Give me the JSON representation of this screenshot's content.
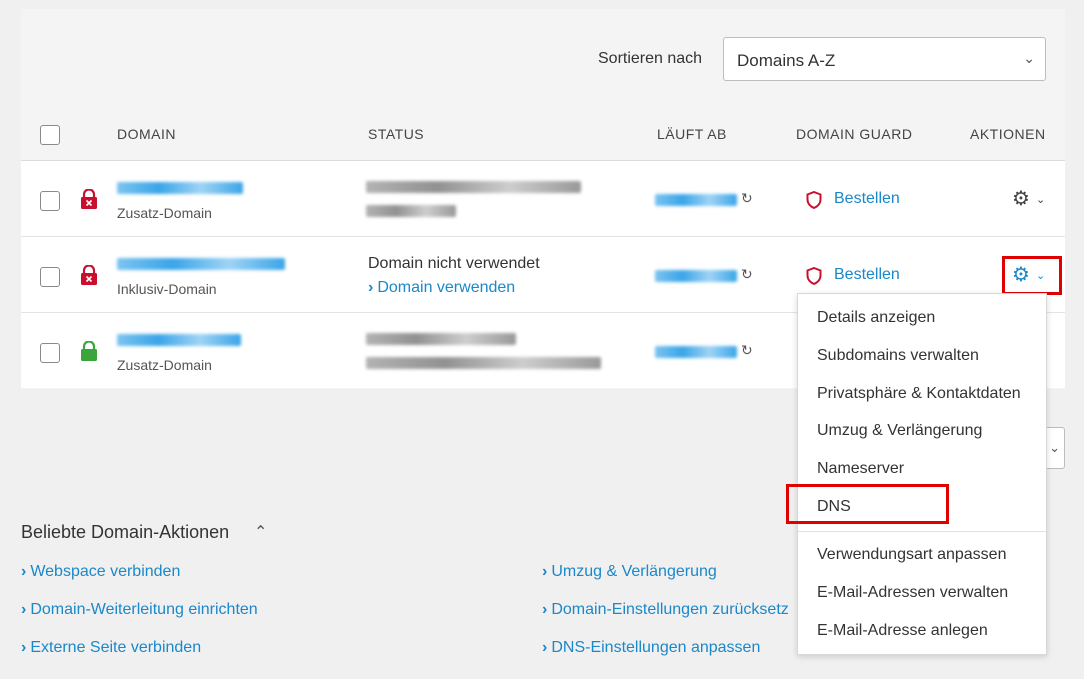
{
  "sort": {
    "label": "Sortieren nach",
    "value": "Domains A-Z"
  },
  "table": {
    "headers": {
      "domain": "DOMAIN",
      "status": "STATUS",
      "expires": "LÄUFT AB",
      "guard": "DOMAIN GUARD",
      "actions": "AKTIONEN"
    },
    "rows": [
      {
        "type": "Zusatz-Domain",
        "lock": "locked-red",
        "guard": "Bestellen"
      },
      {
        "type": "Inklusiv-Domain",
        "lock": "locked-red",
        "status_text": "Domain nicht verwendet",
        "status_link": "Domain verwenden",
        "guard": "Bestellen"
      },
      {
        "type": "Zusatz-Domain",
        "lock": "locked-green"
      }
    ]
  },
  "dropdown": {
    "items": [
      "Details anzeigen",
      "Subdomains verwalten",
      "Privatsphäre & Kontaktdaten",
      "Umzug & Verlängerung",
      "Nameserver",
      "DNS",
      "Verwendungsart anpassen",
      "E-Mail-Adressen verwalten",
      "E-Mail-Adresse anlegen"
    ]
  },
  "popular": {
    "title": "Beliebte Domain-Aktionen",
    "left": [
      "Webspace verbinden",
      "Domain-Weiterleitung einrichten",
      "Externe Seite verbinden"
    ],
    "right": [
      "Umzug & Verlängerung",
      "Domain-Einstellungen zurücksetz",
      "DNS-Einstellungen anpassen"
    ]
  },
  "colors": {
    "link": "#1a88c9",
    "highlight": "#e10000",
    "lock_red": "#c8102e",
    "lock_green": "#3aa53a"
  }
}
